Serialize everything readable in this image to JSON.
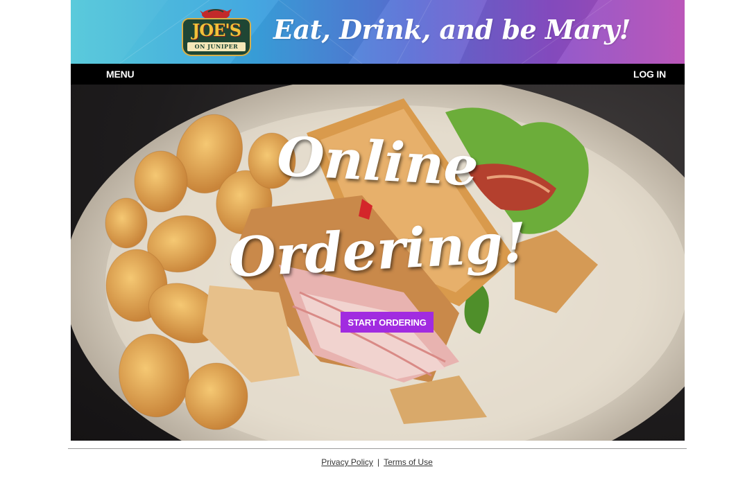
{
  "banner": {
    "logo_main": "JOE'S",
    "logo_sub": "ON JUNIPER",
    "tagline": "Eat, Drink, and be Mary!"
  },
  "nav": {
    "menu_label": "MENU",
    "login_label": "LOG IN"
  },
  "hero": {
    "title_line1": "Online",
    "title_line2": "Ordering!",
    "cta_label": "START ORDERING"
  },
  "footer": {
    "privacy_label": "Privacy Policy",
    "separator": "|",
    "terms_label": "Terms of Use"
  },
  "colors": {
    "accent": "#a12be0",
    "navbar": "#000000",
    "logo_green": "#1f4634",
    "logo_gold": "#f0c23a"
  }
}
